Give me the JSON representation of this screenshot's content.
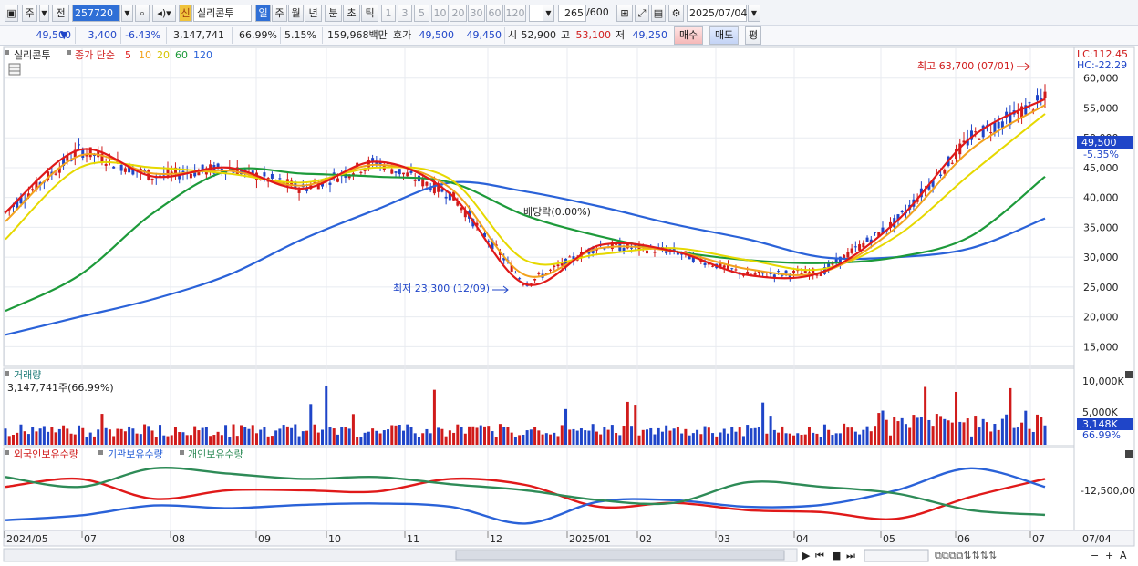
{
  "toolbar": {
    "left_buttons": [
      "주",
      "전"
    ],
    "code": "257720",
    "stock_name": "실리콘투",
    "sin_badge": "신",
    "periods": [
      "일",
      "주",
      "월",
      "년",
      "분",
      "초",
      "틱"
    ],
    "period_selected": "일",
    "intervals": [
      "1",
      "3",
      "5",
      "10",
      "20",
      "30",
      "60",
      "120"
    ],
    "count": "265",
    "count_total": "/600",
    "date": "2025/07/04"
  },
  "quote": {
    "price": "49,500",
    "change": "3,400",
    "change_pct": "-6.43%",
    "volume": "3,147,741",
    "volume_ratio": "66.99%",
    "turnover": "5.15%",
    "amount": "159,968백만",
    "ask_label": "호가",
    "ask": "49,500",
    "bid": "49,450",
    "open_label": "시",
    "open": "52,900",
    "high_label": "고",
    "high": "53,100",
    "low_label": "저",
    "low": "49,250",
    "buy_label": "매수",
    "sell_label": "매도",
    "avg_label": "평"
  },
  "price_panel": {
    "title": "실리콘투",
    "ma_label": "종가 단순",
    "ma_periods": [
      {
        "label": "5",
        "color": "#e01919"
      },
      {
        "label": "10",
        "color": "#f2a21d"
      },
      {
        "label": "20",
        "color": "#e6d800"
      },
      {
        "label": "60",
        "color": "#1d9a3a"
      },
      {
        "label": "120",
        "color": "#2a62d8"
      }
    ],
    "lc": "LC:112.45",
    "hc": "HC:-22.29",
    "annot_high": "최고 63,700 (07/01)",
    "annot_low": "최저 23,300 (12/09)",
    "annot_div": "배당락(0.00%)",
    "last_price_tag": "49,500",
    "last_pct_tag": "-5.35%"
  },
  "volume_panel": {
    "title": "거래량",
    "value": "3,147,741주(66.99%)",
    "last_tag": "3,148K",
    "last_pct": "66.99%"
  },
  "holdings_panel": {
    "legend": [
      {
        "label": "외국인보유수량",
        "color": "#e01919"
      },
      {
        "label": "기관보유수량",
        "color": "#2a62d8"
      },
      {
        "label": "개인보유수량",
        "color": "#2e8b57"
      }
    ]
  },
  "x_axis": {
    "labels": [
      "2024/05",
      "07",
      "08",
      "09",
      "10",
      "11",
      "12",
      "2025/01",
      "02",
      "03",
      "04",
      "05",
      "06",
      "07"
    ],
    "end_label": "07/04"
  },
  "chart_data": [
    {
      "type": "line",
      "name": "price",
      "x": [
        "2024/05",
        "06",
        "07",
        "08",
        "09",
        "10",
        "11",
        "12",
        "2025/01",
        "02",
        "03",
        "04",
        "05",
        "06",
        "07"
      ],
      "series": [
        {
          "name": "5",
          "values": [
            37500,
            48000,
            43500,
            45000,
            41500,
            46000,
            40500,
            25500,
            32000,
            31000,
            27000,
            27500,
            36000,
            50000,
            56500
          ]
        },
        {
          "name": "10",
          "values": [
            36000,
            47000,
            44000,
            44500,
            42000,
            45500,
            41500,
            27000,
            31500,
            31000,
            28000,
            27500,
            35000,
            48000,
            55500
          ]
        },
        {
          "name": "20",
          "values": [
            33000,
            45000,
            45000,
            44000,
            42500,
            45000,
            43000,
            29500,
            30500,
            31500,
            29500,
            28000,
            33500,
            44000,
            54000
          ]
        },
        {
          "name": "60",
          "values": [
            21000,
            27000,
            37500,
            44500,
            44000,
            43500,
            42500,
            37000,
            33500,
            31000,
            29500,
            29000,
            30000,
            33500,
            43500
          ]
        },
        {
          "name": "120",
          "values": [
            17000,
            20000,
            23000,
            27000,
            33000,
            38000,
            42500,
            41000,
            38500,
            35500,
            33000,
            30000,
            30000,
            31500,
            36500
          ]
        }
      ],
      "ylim": [
        12000,
        65000
      ],
      "y_ticks": [
        "60,000",
        "55,000",
        "50,000",
        "45,000",
        "40,000",
        "35,000",
        "30,000",
        "25,000",
        "20,000",
        "15,000"
      ],
      "high": 63700,
      "low": 23300,
      "last": 49500
    },
    {
      "type": "bar",
      "name": "volume",
      "y_ticks": [
        "10,000K",
        "5,000K"
      ],
      "ylim": [
        0,
        12000000
      ],
      "last": 3147741
    },
    {
      "type": "line",
      "name": "holdings",
      "y_ticks": [
        "-12,500,00"
      ],
      "series": [
        {
          "name": "외국인보유수량",
          "values": [
            0.6,
            0.72,
            0.42,
            0.55,
            0.55,
            0.53,
            0.72,
            0.63,
            0.3,
            0.36,
            0.25,
            0.22,
            0.12,
            0.45,
            0.72
          ]
        },
        {
          "name": "기관보유수량",
          "values": [
            0.1,
            0.17,
            0.32,
            0.28,
            0.33,
            0.35,
            0.3,
            0.05,
            0.38,
            0.4,
            0.3,
            0.33,
            0.55,
            0.88,
            0.6
          ]
        },
        {
          "name": "개인보유수량",
          "values": [
            0.75,
            0.6,
            0.88,
            0.8,
            0.72,
            0.75,
            0.64,
            0.55,
            0.4,
            0.36,
            0.67,
            0.6,
            0.5,
            0.25,
            0.18
          ]
        }
      ]
    }
  ]
}
